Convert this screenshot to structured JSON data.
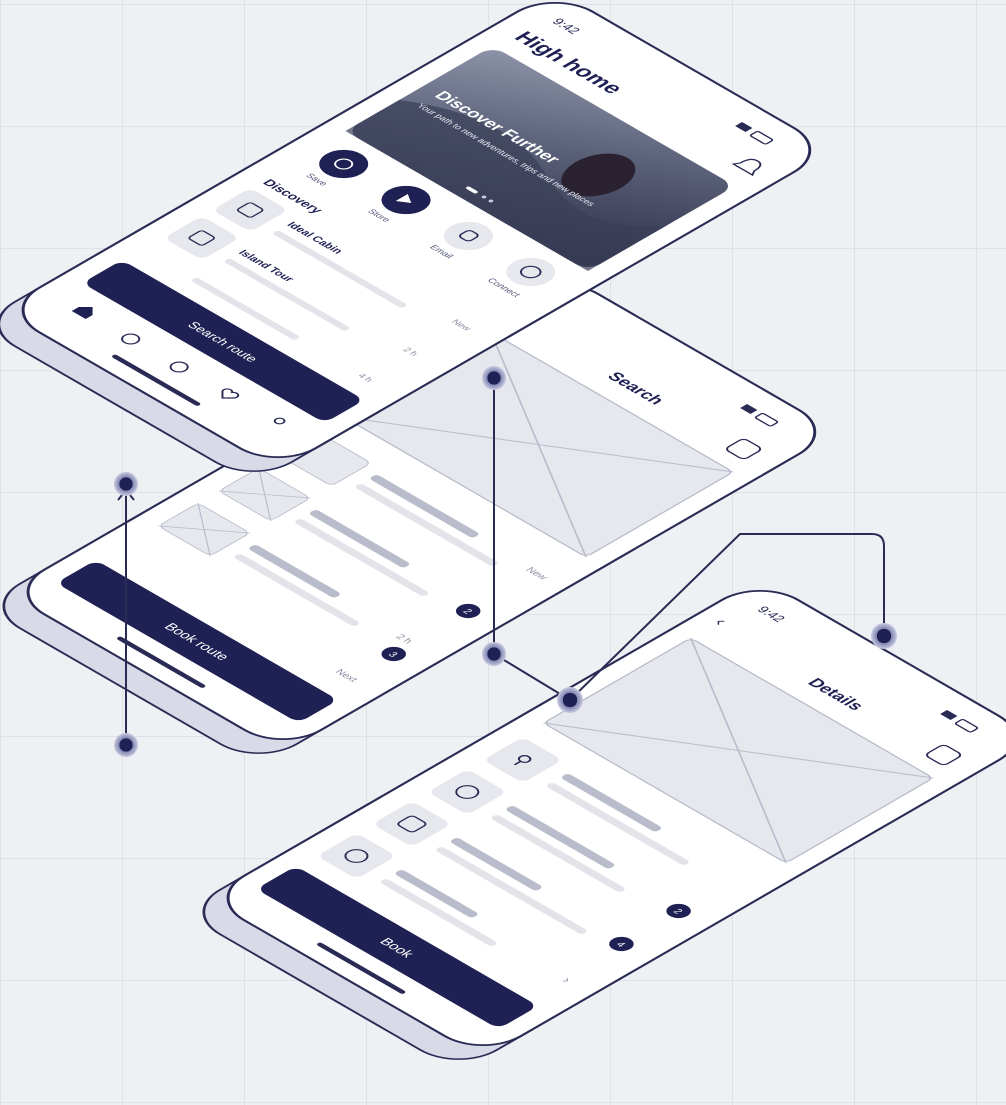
{
  "colors": {
    "navy": "#1f2154",
    "outline": "#2a2b55",
    "device_side": "#dcdce9",
    "screen": "#ffffff",
    "placeholder_fill": "#e6e8ee",
    "placeholder_line": "#b9bccb",
    "background": "#eff0f4",
    "grid": "#dfe1e8"
  },
  "phone_home": {
    "status_time": "9:42",
    "title": "High home",
    "hero_title": "Discover Further",
    "hero_subtitle": "Your path to new adventures, trips and new places",
    "quick_actions": [
      {
        "icon": "camera-icon",
        "label": "Save"
      },
      {
        "icon": "play-icon",
        "label": "Store"
      },
      {
        "icon": "bell-icon",
        "label": "Email"
      },
      {
        "icon": "plus-icon",
        "label": "Connect"
      }
    ],
    "section_title": "Discovery",
    "list_items": [
      {
        "icon": "image-icon",
        "title": "Ideal Cabin",
        "meta": "New"
      },
      {
        "icon": "image-icon",
        "title": "Island Tour",
        "meta": "2 h"
      },
      {
        "icon": "image-icon",
        "title": "",
        "meta": "4 h"
      }
    ],
    "cta_label": "Search route",
    "tab_icons": [
      "home-icon",
      "search-icon",
      "explore-icon",
      "heart-icon",
      "profile-icon"
    ]
  },
  "phone_search": {
    "title": "Search",
    "cta_label": "Book route",
    "badge_1": "2",
    "badge_2": "3",
    "meta_1": "New",
    "meta_2": "2 h",
    "meta_3": "Next"
  },
  "phone_details": {
    "status_time": "9:42",
    "title": "Details",
    "cta_label": "Book",
    "badge_1": "2",
    "badge_2": "4"
  }
}
